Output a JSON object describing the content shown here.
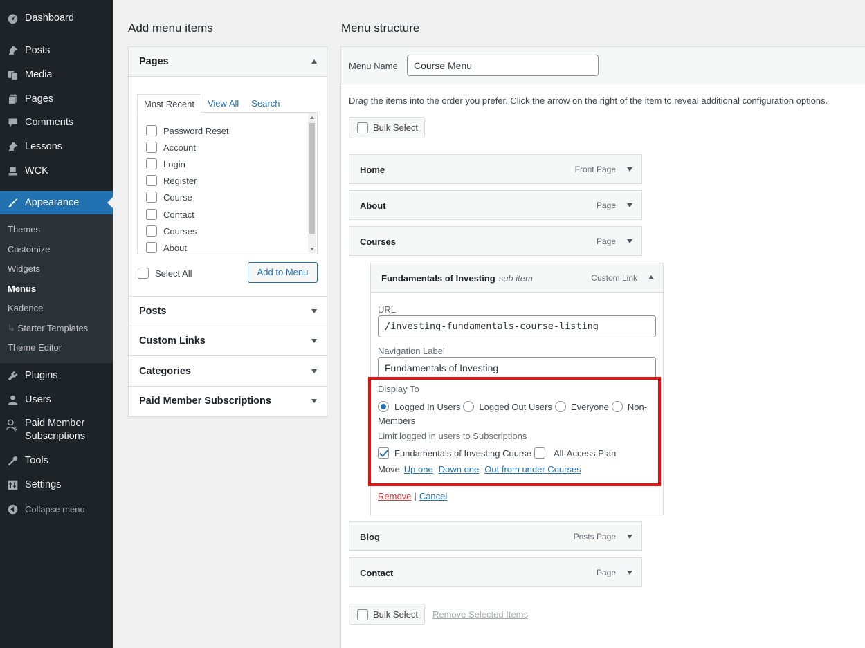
{
  "sidebar": {
    "items": [
      {
        "label": "Dashboard",
        "icon": "dashboard-icon"
      },
      {
        "label": "Posts",
        "icon": "pin-icon"
      },
      {
        "label": "Media",
        "icon": "media-icon"
      },
      {
        "label": "Pages",
        "icon": "pages-icon"
      },
      {
        "label": "Comments",
        "icon": "comments-icon"
      },
      {
        "label": "Lessons",
        "icon": "pin-icon"
      },
      {
        "label": "WCK",
        "icon": "wck-icon"
      },
      {
        "label": "Appearance",
        "icon": "brush-icon"
      },
      {
        "label": "Plugins",
        "icon": "plugin-icon"
      },
      {
        "label": "Users",
        "icon": "users-icon"
      },
      {
        "label": "Paid Member",
        "label2": "Subscriptions",
        "icon": "members-icon"
      },
      {
        "label": "Tools",
        "icon": "wrench-icon"
      },
      {
        "label": "Settings",
        "icon": "settings-icon"
      },
      {
        "label": "Collapse menu",
        "icon": "collapse-icon"
      }
    ],
    "submenu": [
      "Themes",
      "Customize",
      "Widgets",
      "Menus",
      "Kadence",
      "Starter Templates",
      "Theme Editor"
    ],
    "submenu_current": "Menus"
  },
  "left": {
    "title": "Add menu items",
    "pages": {
      "title": "Pages",
      "tabs": [
        "Most Recent",
        "View All",
        "Search"
      ],
      "items": [
        "Password Reset",
        "Account",
        "Login",
        "Register",
        "Course",
        "Contact",
        "Courses",
        "About"
      ],
      "select_all": "Select All",
      "add_button": "Add to Menu"
    },
    "sections": [
      "Posts",
      "Custom Links",
      "Categories",
      "Paid Member Subscriptions"
    ]
  },
  "right": {
    "title": "Menu structure",
    "menu_name_label": "Menu Name",
    "menu_name_value": "Course Menu",
    "instructions": "Drag the items into the order you prefer. Click the arrow on the right of the item to reveal additional configuration options.",
    "bulk_select": "Bulk Select",
    "remove_selected": "Remove Selected Items",
    "items": [
      {
        "title": "Home",
        "kind": "Front Page"
      },
      {
        "title": "About",
        "kind": "Page"
      },
      {
        "title": "Courses",
        "kind": "Page"
      },
      {
        "title": "Blog",
        "kind": "Posts Page"
      },
      {
        "title": "Contact",
        "kind": "Page"
      }
    ],
    "sub_item": {
      "title": "Fundamentals of Investing",
      "sub_label": "sub item",
      "kind": "Custom Link",
      "url_label": "URL",
      "url_value": "/investing-fundamentals-course-listing",
      "nav_label": "Navigation Label",
      "nav_value": "Fundamentals of Investing",
      "display_to": "Display To",
      "display_options": [
        "Logged In Users",
        "Logged Out Users",
        "Everyone",
        "Non-"
      ],
      "display_options_wrap": "Members",
      "display_selected": "Logged In Users",
      "limit_label": "Limit logged in users to Subscriptions",
      "subscriptions": [
        {
          "label": "Fundamentals of Investing Course",
          "checked": true
        },
        {
          "label": "All-Access Plan",
          "checked": false
        }
      ],
      "move_label": "Move",
      "move_links": [
        "Up one",
        "Down one",
        "Out from under Courses"
      ],
      "remove": "Remove",
      "separator": "|",
      "cancel": "Cancel"
    },
    "highlight_color": "#e81010"
  }
}
